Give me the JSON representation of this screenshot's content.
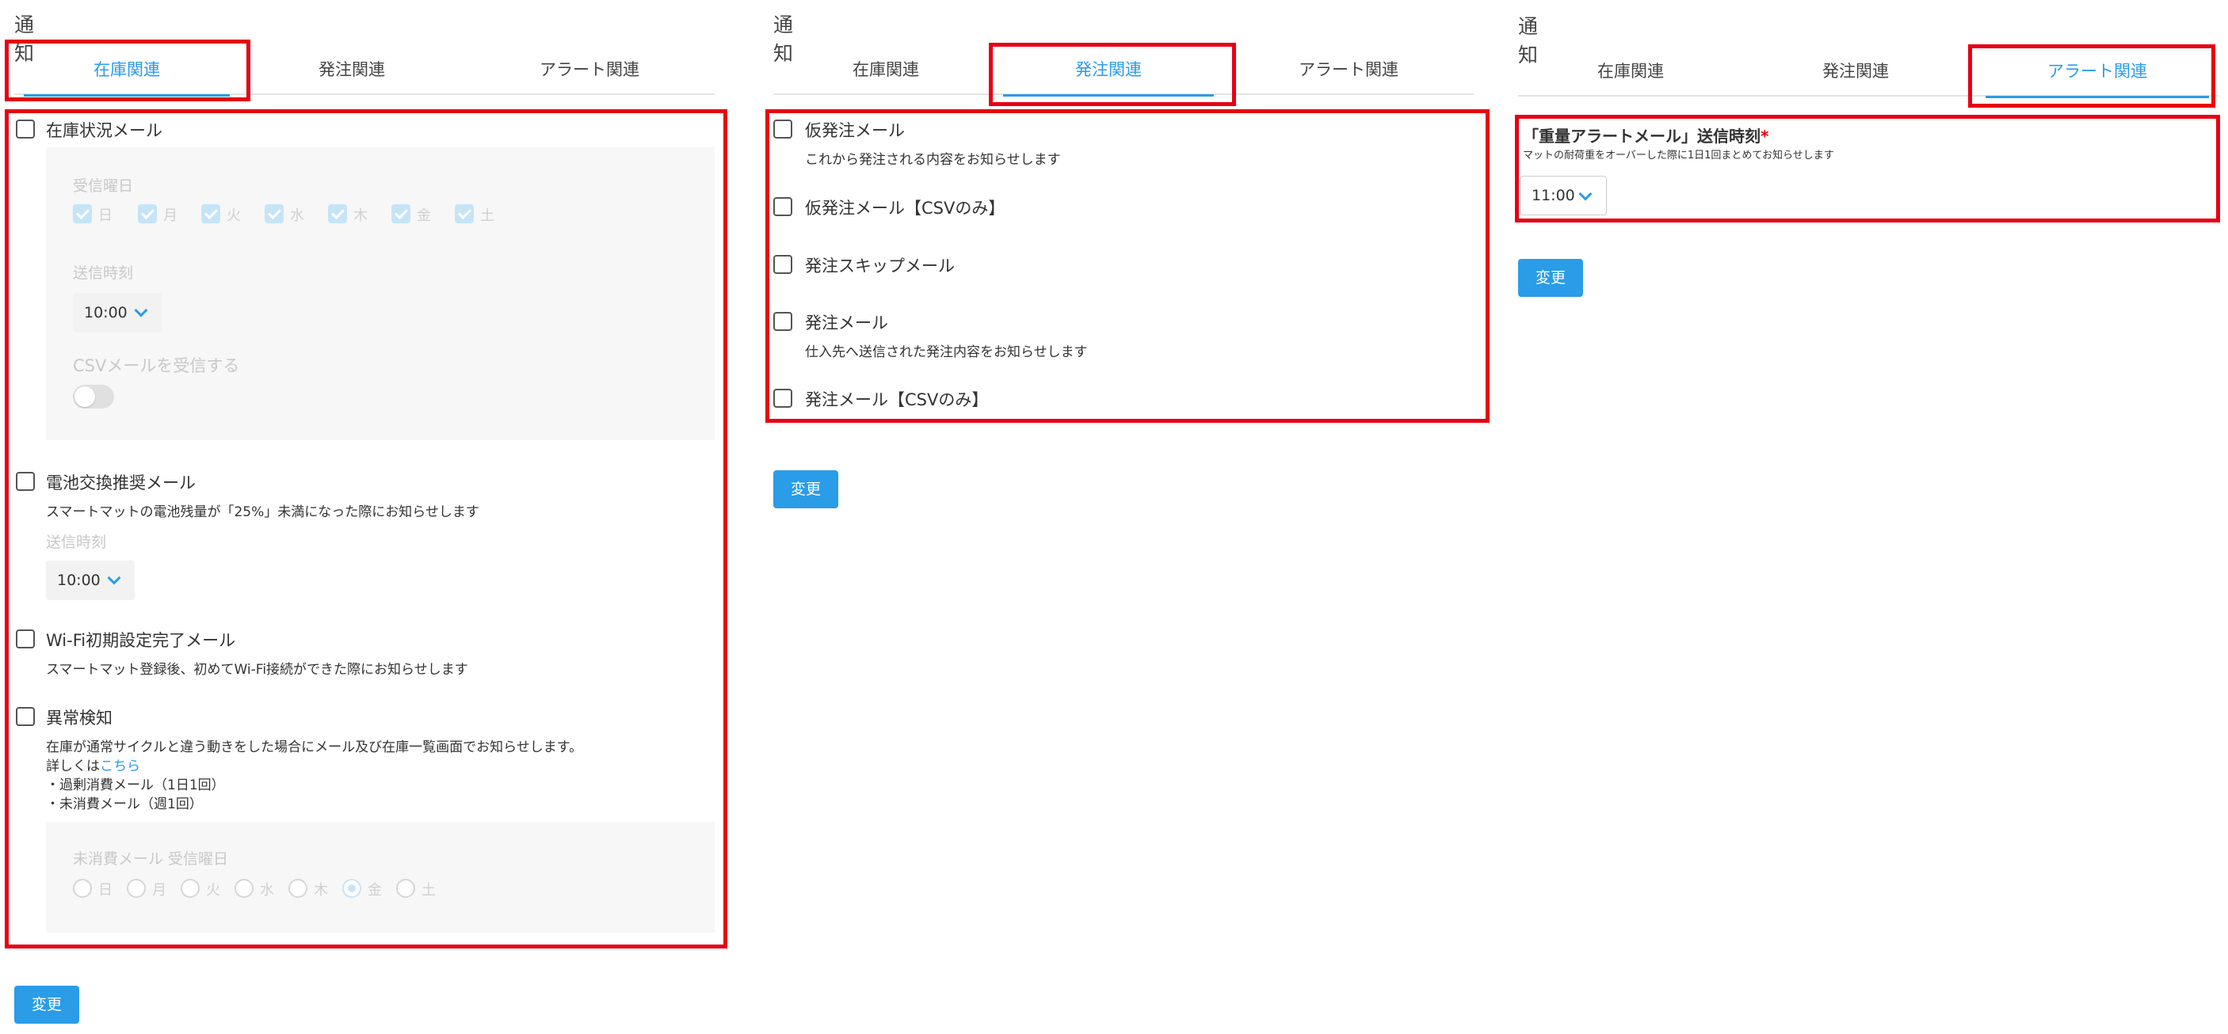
{
  "panels": [
    {
      "title": "通知",
      "tabs": [
        "在庫関連",
        "発注関連",
        "アラート関連"
      ],
      "active_tab": 0,
      "items": {
        "stock_mail": {
          "label": "在庫状況メール",
          "receive_day_label": "受信曜日",
          "days": [
            "日",
            "月",
            "火",
            "水",
            "木",
            "金",
            "土"
          ],
          "send_time_label": "送信時刻",
          "send_time_value": "10:00",
          "csv_label": "CSVメールを受信する"
        },
        "battery_mail": {
          "label": "電池交換推奨メール",
          "desc": "スマートマットの電池残量が「25%」未満になった際にお知らせします",
          "send_time_label": "送信時刻",
          "send_time_value": "10:00"
        },
        "wifi_mail": {
          "label": "Wi-Fi初期設定完了メール",
          "desc": "スマートマット登録後、初めてWi-Fi接続ができた際にお知らせします"
        },
        "anomaly": {
          "label": "異常検知",
          "desc": "在庫が通常サイクルと違う動きをした場合にメール及び在庫一覧画面でお知らせします。",
          "detail_prefix": "詳しくは",
          "detail_link": "こちら",
          "bullet1": "・過剰消費メール（1日1回）",
          "bullet2": "・未消費メール（週1回）",
          "unconsumed_day_label": "未消費メール 受信曜日",
          "days": [
            "日",
            "月",
            "火",
            "水",
            "木",
            "金",
            "土"
          ],
          "selected_day": "金"
        }
      },
      "button": "変更"
    },
    {
      "title": "通知",
      "tabs": [
        "在庫関連",
        "発注関連",
        "アラート関連"
      ],
      "active_tab": 1,
      "items": [
        {
          "label": "仮発注メール",
          "desc": "これから発注される内容をお知らせします"
        },
        {
          "label": "仮発注メール【CSVのみ】",
          "desc": ""
        },
        {
          "label": "発注スキップメール",
          "desc": ""
        },
        {
          "label": "発注メール",
          "desc": "仕入先へ送信された発注内容をお知らせします"
        },
        {
          "label": "発注メール【CSVのみ】",
          "desc": ""
        }
      ],
      "button": "変更"
    },
    {
      "title": "通知",
      "tabs": [
        "在庫関連",
        "発注関連",
        "アラート関連"
      ],
      "active_tab": 2,
      "alert": {
        "label": "「重量アラートメール」送信時刻",
        "required_mark": "*",
        "desc": "マットの耐荷重をオーバーした際に1日1回まとめてお知らせします",
        "time_value": "11:00"
      },
      "button": "変更"
    }
  ],
  "colors": {
    "accent": "#2a9ce8",
    "highlight": "#e60012"
  }
}
